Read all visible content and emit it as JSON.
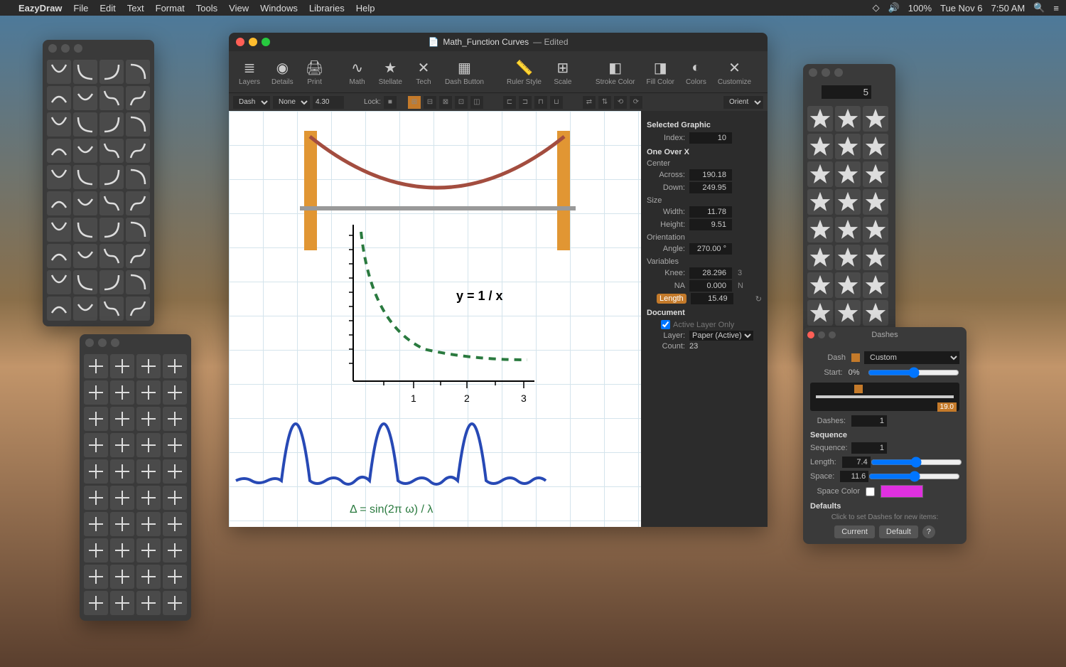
{
  "menubar": {
    "app": "EazyDraw",
    "items": [
      "File",
      "Edit",
      "Text",
      "Format",
      "Tools",
      "View",
      "Windows",
      "Libraries",
      "Help"
    ],
    "battery": "100%",
    "date": "Tue Nov 6",
    "time": "7:50 AM"
  },
  "doc": {
    "title": "Math_Function Curves",
    "edited": "— Edited",
    "toolbar": [
      "Layers",
      "Details",
      "Print",
      "",
      "Math",
      "Stellate",
      "Tech",
      "Dash Button",
      "",
      "Ruler Style",
      "Scale",
      "",
      "Stroke Color",
      "Fill Color",
      "Colors",
      "Customize"
    ],
    "opt": {
      "dash": "Dash",
      "none": "None",
      "zoom": "4.30",
      "lock": "Lock:",
      "orient": "Orient"
    },
    "eq1": "y = 1 / x",
    "eq2": "Δ = sin(2π ω) / λ",
    "x_ticks": [
      "1",
      "2",
      "3"
    ],
    "insp": {
      "sel": "Selected Graphic",
      "index_l": "Index:",
      "index": "10",
      "oneover": "One Over X",
      "center": "Center",
      "across_l": "Across:",
      "across": "190.18",
      "down_l": "Down:",
      "down": "249.95",
      "size": "Size",
      "width_l": "Width:",
      "width": "11.78",
      "height_l": "Height:",
      "height": "9.51",
      "orient": "Orientation",
      "angle_l": "Angle:",
      "angle": "270.00 °",
      "vars": "Variables",
      "knee_l": "Knee:",
      "knee": "28.296",
      "na_l": "NA",
      "na": "0.000",
      "kside": "3",
      "nside": "N",
      "length_l": "Length",
      "length": "15.49",
      "document": "Document",
      "activelayer": "Active Layer Only",
      "layer_l": "Layer:",
      "layer": "Paper (Active)",
      "count_l": "Count:",
      "count": "23"
    }
  },
  "stellate": {
    "sides": "5"
  },
  "dashes": {
    "title": "Dashes",
    "dash_l": "Dash",
    "dash_mode": "Custom",
    "start_l": "Start:",
    "start": "0%",
    "badge": "19.0",
    "dashes_l": "Dashes:",
    "dashes_v": "1",
    "seq": "Sequence",
    "sequence_l": "Sequence:",
    "sequence_v": "1",
    "length_l": "Length:",
    "length_v": "7.4",
    "space_l": "Space:",
    "space_v": "11.6",
    "spcolor_l": "Space Color",
    "defaults": "Defaults",
    "hint": "Click to set Dashes for new items:",
    "current": "Current",
    "default": "Default"
  }
}
